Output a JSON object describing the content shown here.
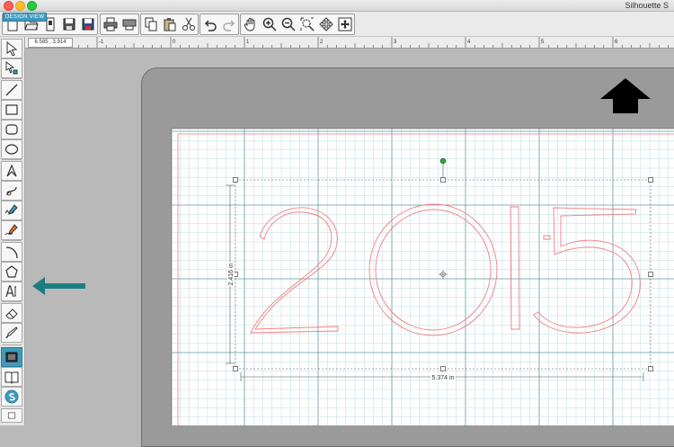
{
  "app": {
    "title": "Silhouette S"
  },
  "ruler": {
    "coordinates": "6.585 , 3.914",
    "ticks": [
      "-1",
      "0",
      "1",
      "2",
      "3",
      "4",
      "5",
      "6"
    ]
  },
  "view_label": "DESIGN VIEW",
  "design": {
    "text": "2015",
    "height_label": "2.416 in",
    "width_label": "5.374 in"
  },
  "colors": {
    "accent": "#3f9bbd",
    "text_outline": "#f07f83",
    "annotation_arrow": "#1c7d80"
  },
  "toolbar_icons": [
    "new-document-icon",
    "open-folder-icon",
    "template-icon",
    "save-icon",
    "save-to-library-icon",
    "print-icon",
    "cut-settings-icon",
    "copy-icon",
    "paste-icon",
    "cut-icon",
    "undo-icon",
    "redo-icon",
    "pan-hand-icon",
    "zoom-in-icon",
    "zoom-out-icon",
    "zoom-select-icon",
    "zoom-drag-icon",
    "fit-to-page-icon"
  ],
  "left_tool_icons": [
    "select-icon",
    "point-edit-icon",
    "line-icon",
    "rectangle-icon",
    "rounded-rectangle-icon",
    "ellipse-icon",
    "polygon-icon",
    "curve-icon",
    "freehand-icon",
    "smooth-freehand-icon",
    "arc-icon",
    "regular-polygon-icon",
    "text-icon",
    "eraser-icon",
    "knife-icon",
    "design-page-icon",
    "library-icon",
    "store-icon"
  ]
}
